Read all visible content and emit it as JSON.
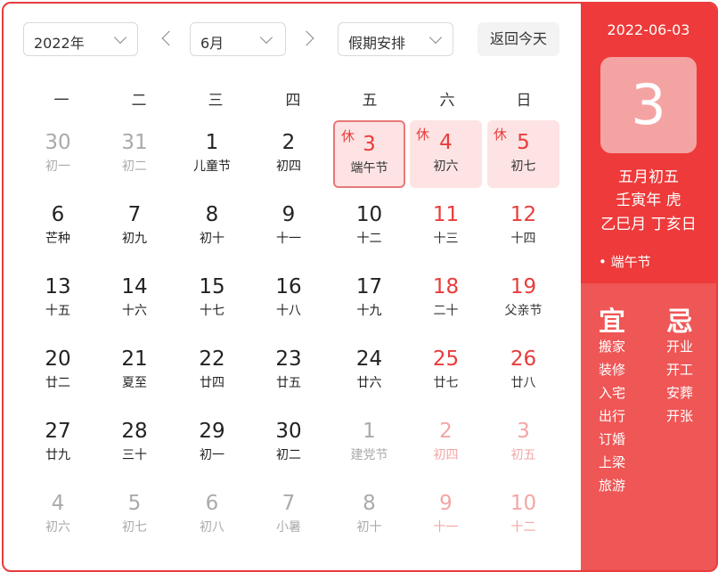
{
  "header": {
    "year_label": "2022年",
    "month_label": "6月",
    "holiday_label": "假期安排",
    "today_button": "返回今天"
  },
  "weekdays": [
    "一",
    "二",
    "三",
    "四",
    "五",
    "六",
    "日"
  ],
  "days": [
    {
      "num": "30",
      "sub": "初一",
      "type": "other"
    },
    {
      "num": "31",
      "sub": "初二",
      "type": "other"
    },
    {
      "num": "1",
      "sub": "儿童节",
      "type": "normal"
    },
    {
      "num": "2",
      "sub": "初四",
      "type": "normal"
    },
    {
      "num": "3",
      "sub": "端午节",
      "type": "holiday",
      "rest": "休",
      "selected": true
    },
    {
      "num": "4",
      "sub": "初六",
      "type": "holiday",
      "rest": "休"
    },
    {
      "num": "5",
      "sub": "初七",
      "type": "holiday",
      "rest": "休"
    },
    {
      "num": "6",
      "sub": "芒种",
      "type": "normal"
    },
    {
      "num": "7",
      "sub": "初九",
      "type": "normal"
    },
    {
      "num": "8",
      "sub": "初十",
      "type": "normal"
    },
    {
      "num": "9",
      "sub": "十一",
      "type": "normal"
    },
    {
      "num": "10",
      "sub": "十二",
      "type": "normal"
    },
    {
      "num": "11",
      "sub": "十三",
      "type": "weekend"
    },
    {
      "num": "12",
      "sub": "十四",
      "type": "weekend"
    },
    {
      "num": "13",
      "sub": "十五",
      "type": "normal"
    },
    {
      "num": "14",
      "sub": "十六",
      "type": "normal"
    },
    {
      "num": "15",
      "sub": "十七",
      "type": "normal"
    },
    {
      "num": "16",
      "sub": "十八",
      "type": "normal"
    },
    {
      "num": "17",
      "sub": "十九",
      "type": "normal"
    },
    {
      "num": "18",
      "sub": "二十",
      "type": "weekend"
    },
    {
      "num": "19",
      "sub": "父亲节",
      "type": "weekend"
    },
    {
      "num": "20",
      "sub": "廿二",
      "type": "normal"
    },
    {
      "num": "21",
      "sub": "夏至",
      "type": "normal"
    },
    {
      "num": "22",
      "sub": "廿四",
      "type": "normal"
    },
    {
      "num": "23",
      "sub": "廿五",
      "type": "normal"
    },
    {
      "num": "24",
      "sub": "廿六",
      "type": "normal"
    },
    {
      "num": "25",
      "sub": "廿七",
      "type": "weekend"
    },
    {
      "num": "26",
      "sub": "廿八",
      "type": "weekend"
    },
    {
      "num": "27",
      "sub": "廿九",
      "type": "normal"
    },
    {
      "num": "28",
      "sub": "三十",
      "type": "normal"
    },
    {
      "num": "29",
      "sub": "初一",
      "type": "normal"
    },
    {
      "num": "30",
      "sub": "初二",
      "type": "normal"
    },
    {
      "num": "1",
      "sub": "建党节",
      "type": "other"
    },
    {
      "num": "2",
      "sub": "初四",
      "type": "other-weekend"
    },
    {
      "num": "3",
      "sub": "初五",
      "type": "other-weekend"
    },
    {
      "num": "4",
      "sub": "初六",
      "type": "other"
    },
    {
      "num": "5",
      "sub": "初七",
      "type": "other"
    },
    {
      "num": "6",
      "sub": "初八",
      "type": "other"
    },
    {
      "num": "7",
      "sub": "小暑",
      "type": "other"
    },
    {
      "num": "8",
      "sub": "初十",
      "type": "other"
    },
    {
      "num": "9",
      "sub": "十一",
      "type": "other-weekend"
    },
    {
      "num": "10",
      "sub": "十二",
      "type": "other-weekend"
    }
  ],
  "panel": {
    "date": "2022-06-03",
    "big_day": "3",
    "lunar_date": "五月初五",
    "year_ganzhi": "壬寅年 虎",
    "month_day_ganzhi": "乙巳月 丁亥日",
    "festival": "• 端午节",
    "yi_title": "宜",
    "ji_title": "忌",
    "yi_items": [
      "搬家",
      "装修",
      "入宅",
      "出行",
      "订婚",
      "上梁",
      "旅游"
    ],
    "ji_items": [
      "开业",
      "开工",
      "安葬",
      "开张"
    ]
  },
  "colors": {
    "accent": "#ee3a3a",
    "accent_light": "#ef5656",
    "holiday_bg": "#fde3e3",
    "big_box": "#f4a3a3"
  }
}
